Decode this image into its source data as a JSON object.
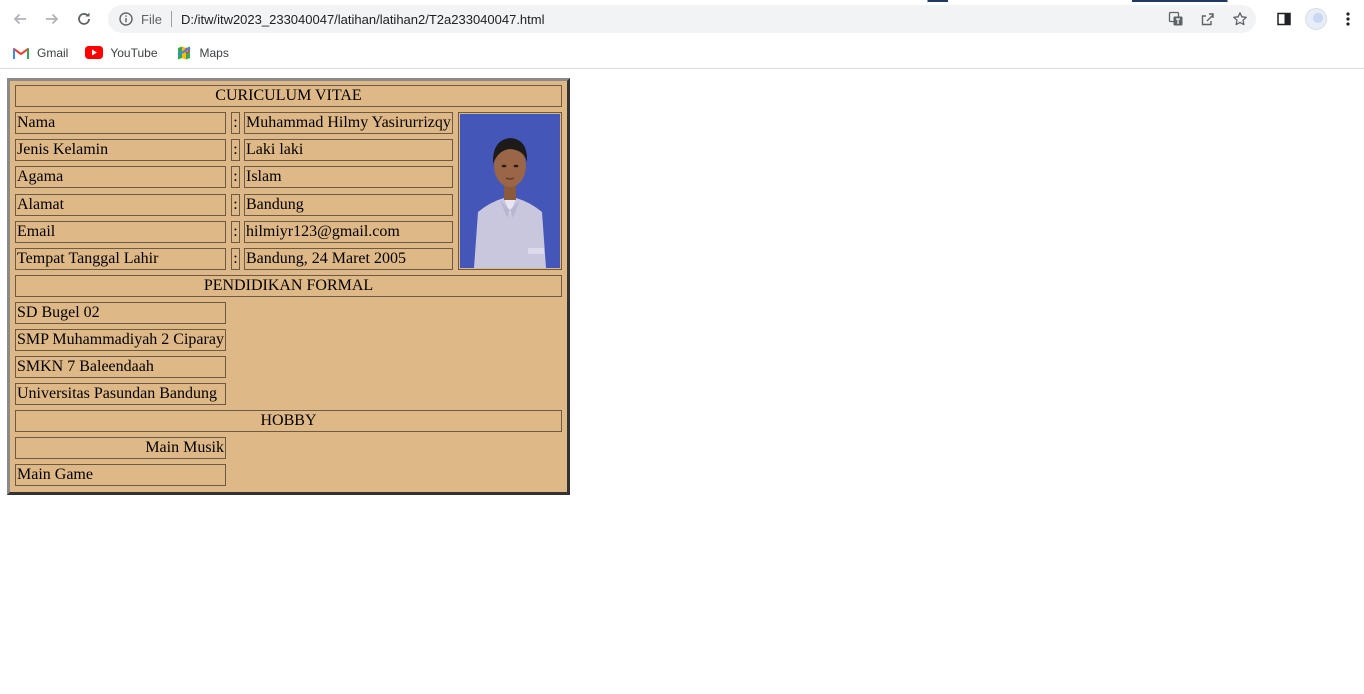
{
  "browser": {
    "omnibox": {
      "scheme_label": "File",
      "url": "D:/itw/itw2023_233040047/latihan/latihan2/T2a233040047.html"
    },
    "bookmarks": [
      {
        "label": "Gmail",
        "icon": "gmail-icon"
      },
      {
        "label": "YouTube",
        "icon": "youtube-icon"
      },
      {
        "label": "Maps",
        "icon": "maps-icon"
      }
    ]
  },
  "cv": {
    "title": "CURICULUM VITAE",
    "separator": ":",
    "personal": [
      {
        "label": "Nama",
        "value": "Muhammad Hilmy Yasirurrizqy"
      },
      {
        "label": "Jenis Kelamin",
        "value": "Laki laki"
      },
      {
        "label": "Agama",
        "value": "Islam"
      },
      {
        "label": "Alamat",
        "value": "Bandung"
      },
      {
        "label": "Email",
        "value": "hilmiyr123@gmail.com"
      },
      {
        "label": "Tempat Tanggal Lahir",
        "value": "Bandung, 24 Maret 2005"
      }
    ],
    "photo": {
      "background": "#4357b6"
    },
    "education_heading": "PENDIDIKAN FORMAL",
    "education": [
      "SD Bugel 02",
      "SMP Muhammadiyah 2 Ciparay",
      "SMKN 7 Baleendaah",
      "Universitas Pasundan Bandung"
    ],
    "hobby_heading": "HOBBY",
    "hobbies": [
      "Main Musik",
      "Main Game"
    ]
  },
  "colors": {
    "table_background": "#deb887",
    "cell_border": "#6b5a45"
  }
}
